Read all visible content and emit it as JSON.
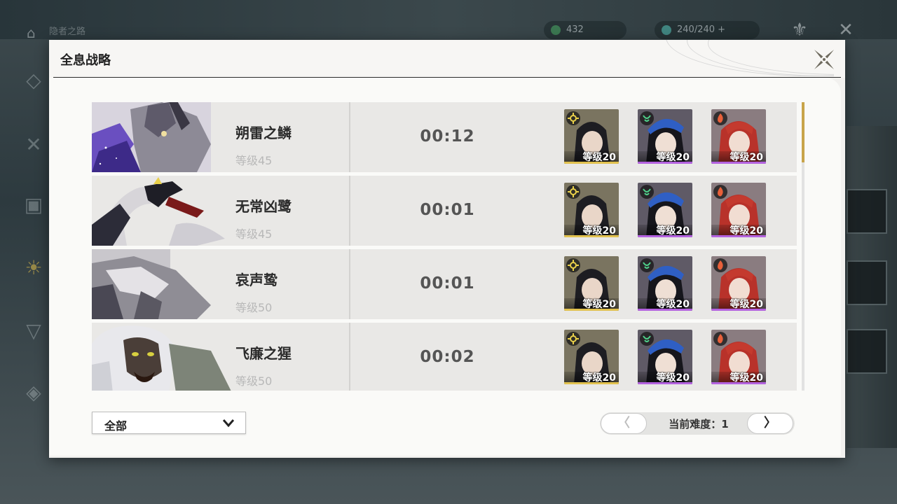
{
  "header": {
    "title": "全息战略",
    "background_title": "隐者之路",
    "currency_1": "432",
    "currency_2": "240/240"
  },
  "bosses": [
    {
      "name": "朔雷之鳞",
      "level": "等级45",
      "time": "00:12",
      "team": [
        {
          "level": "等级20",
          "element": "spectro-icon"
        },
        {
          "level": "等级20",
          "element": "aero-icon"
        },
        {
          "level": "等级20",
          "element": "fusion-icon"
        }
      ]
    },
    {
      "name": "无常凶鹭",
      "level": "等级45",
      "time": "00:01",
      "team": [
        {
          "level": "等级20",
          "element": "spectro-icon"
        },
        {
          "level": "等级20",
          "element": "aero-icon"
        },
        {
          "level": "等级20",
          "element": "fusion-icon"
        }
      ]
    },
    {
      "name": "哀声鸷",
      "level": "等级50",
      "time": "00:01",
      "team": [
        {
          "level": "等级20",
          "element": "spectro-icon"
        },
        {
          "level": "等级20",
          "element": "aero-icon"
        },
        {
          "level": "等级20",
          "element": "fusion-icon"
        }
      ]
    },
    {
      "name": "飞廉之猩",
      "level": "等级50",
      "time": "00:02",
      "team": [
        {
          "level": "等级20",
          "element": "spectro-icon"
        },
        {
          "level": "等级20",
          "element": "aero-icon"
        },
        {
          "level": "等级20",
          "element": "fusion-icon"
        }
      ]
    }
  ],
  "filter": {
    "selected": "全部"
  },
  "pager": {
    "label": "当前难度：1",
    "prev": "〈",
    "next": "〉"
  },
  "colors": {
    "accent_gold": "#c8a44a",
    "spectro": "#e9d04a",
    "aero": "#4fd08a",
    "fusion": "#e8603a",
    "rarity_5": "#e2c24f",
    "rarity_4": "#b462e0"
  }
}
